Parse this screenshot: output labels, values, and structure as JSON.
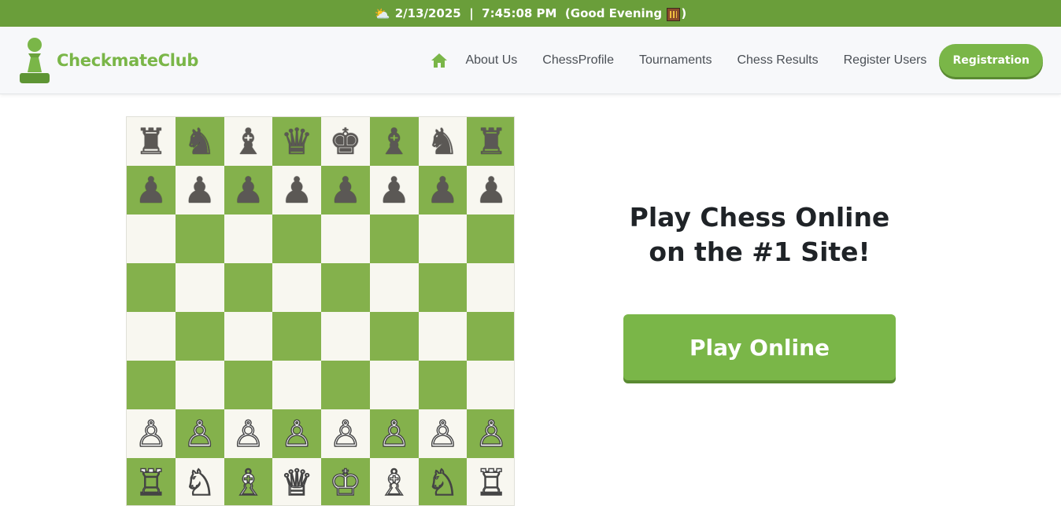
{
  "topbar": {
    "date": "2/13/2025",
    "separator": "|",
    "time": "7:45:08 PM",
    "greeting_open": "(Good Evening",
    "greeting_close": ")",
    "weather_icon": "⛅",
    "greeting_icon": "building-icon"
  },
  "brand": {
    "name": "CheckmateClub",
    "logo_icon": "pawn-icon"
  },
  "nav": {
    "home_icon": "home-icon",
    "links": [
      "About Us",
      "ChessProfile",
      "Tournaments",
      "Chess Results",
      "Register Users"
    ],
    "cta": "Registration"
  },
  "board": {
    "rows": [
      [
        "♜",
        "♞",
        "♝",
        "♛",
        "♚",
        "♝",
        "♞",
        "♜"
      ],
      [
        "♟",
        "♟",
        "♟",
        "♟",
        "♟",
        "♟",
        "♟",
        "♟"
      ],
      [
        "",
        "",
        "",
        "",
        "",
        "",
        "",
        ""
      ],
      [
        "",
        "",
        "",
        "",
        "",
        "",
        "",
        ""
      ],
      [
        "",
        "",
        "",
        "",
        "",
        "",
        "",
        ""
      ],
      [
        "",
        "",
        "",
        "",
        "",
        "",
        "",
        ""
      ],
      [
        "♙",
        "♙",
        "♙",
        "♙",
        "♙",
        "♙",
        "♙",
        "♙"
      ],
      [
        "♖",
        "♘",
        "♗",
        "♕",
        "♔",
        "♗",
        "♘",
        "♖"
      ]
    ]
  },
  "hero": {
    "title_line1": "Play Chess Online",
    "title_line2": "on the #1 Site!",
    "play_button": "Play Online"
  },
  "colors": {
    "accent": "#7ab648",
    "topbar": "#6a9e3a",
    "board_dark": "#84b14c",
    "board_light": "#f8f7f0"
  }
}
